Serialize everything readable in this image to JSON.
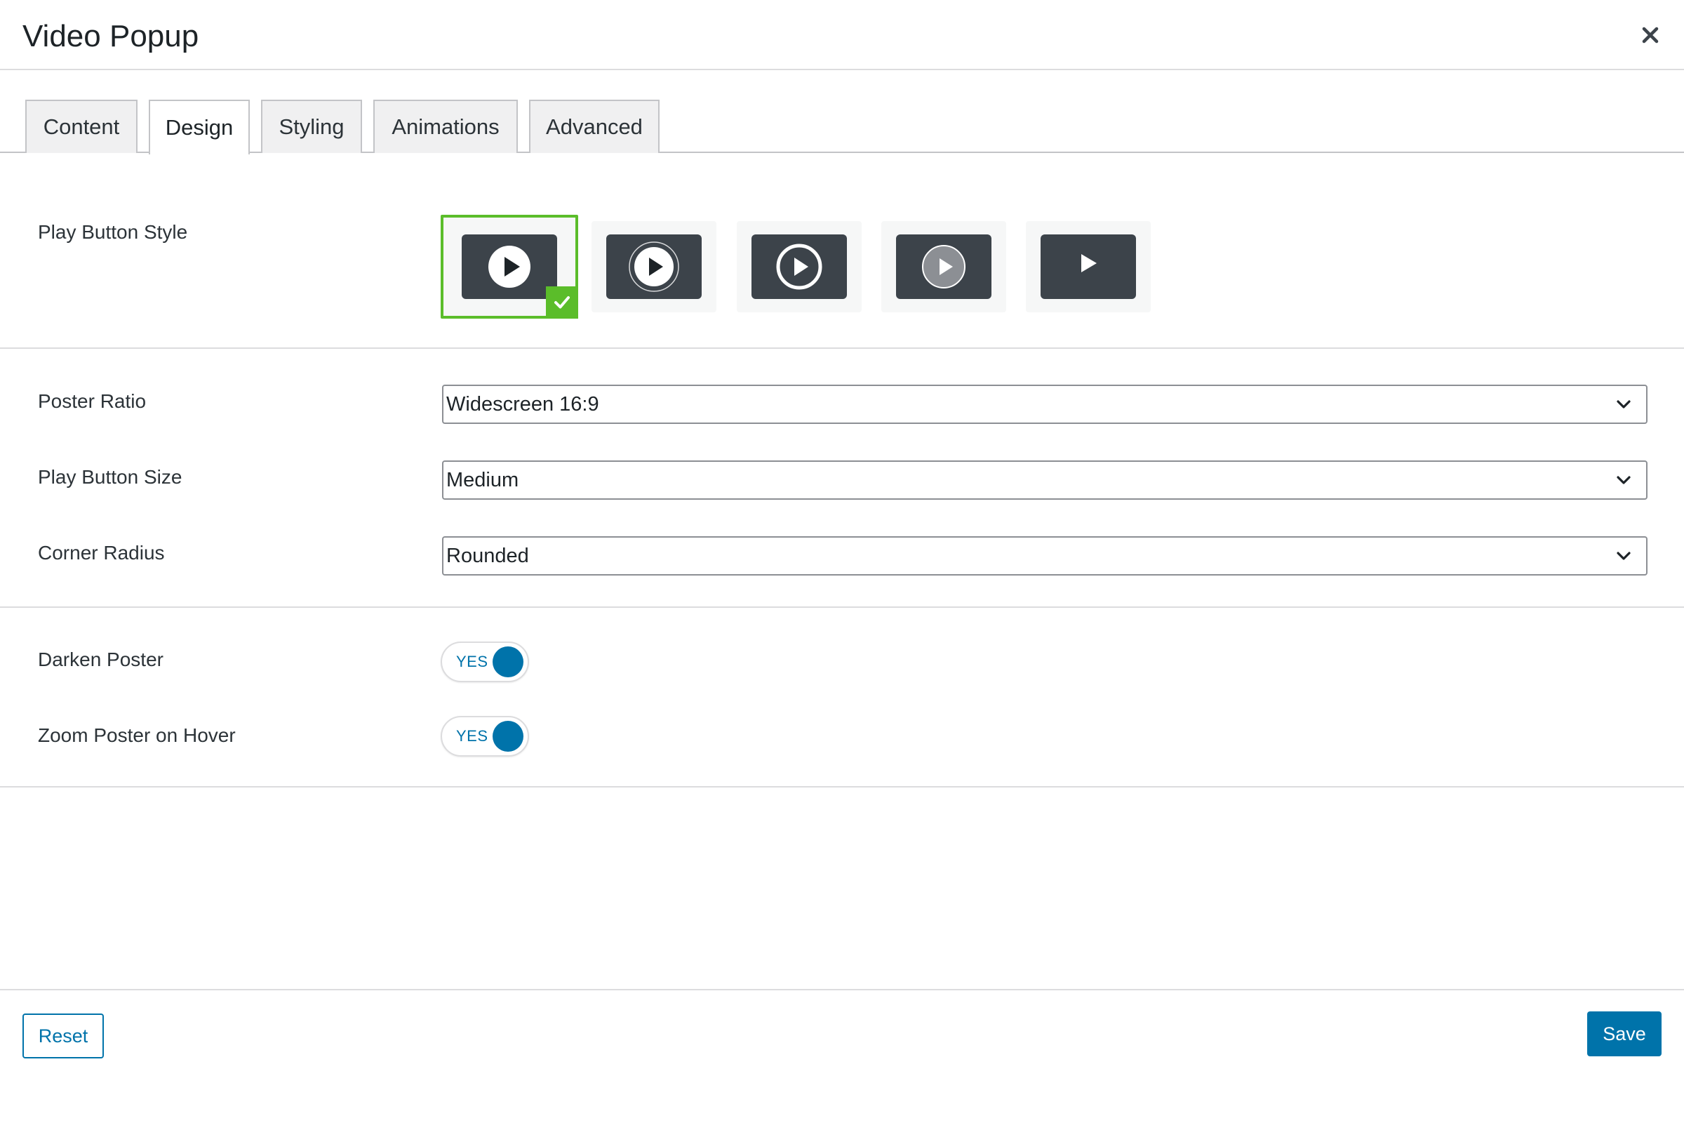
{
  "dialog": {
    "title": "Video Popup",
    "close_icon": "close-icon"
  },
  "tabs": [
    {
      "label": "Content",
      "active": false
    },
    {
      "label": "Design",
      "active": true
    },
    {
      "label": "Styling",
      "active": false
    },
    {
      "label": "Animations",
      "active": false
    },
    {
      "label": "Advanced",
      "active": false
    }
  ],
  "play_button_style": {
    "label": "Play Button Style",
    "selected_index": 0,
    "options": [
      {
        "icon": "play-filled-circle-icon"
      },
      {
        "icon": "play-filled-circle-ring-icon"
      },
      {
        "icon": "play-outline-circle-icon"
      },
      {
        "icon": "play-translucent-circle-icon"
      },
      {
        "icon": "play-triangle-icon"
      }
    ],
    "selected_icon": "check-icon"
  },
  "selects": {
    "poster_ratio": {
      "label": "Poster Ratio",
      "value": "Widescreen 16:9"
    },
    "play_button_size": {
      "label": "Play Button Size",
      "value": "Medium"
    },
    "corner_radius": {
      "label": "Corner Radius",
      "value": "Rounded"
    }
  },
  "toggles": {
    "darken_poster": {
      "label": "Darken Poster",
      "state": "YES"
    },
    "zoom_poster": {
      "label": "Zoom Poster on Hover",
      "state": "YES"
    }
  },
  "footer": {
    "reset_label": "Reset",
    "save_label": "Save"
  },
  "colors": {
    "accent": "#0073aa",
    "selected_border": "#5bbd2a",
    "tile_dark": "#3c434a"
  }
}
